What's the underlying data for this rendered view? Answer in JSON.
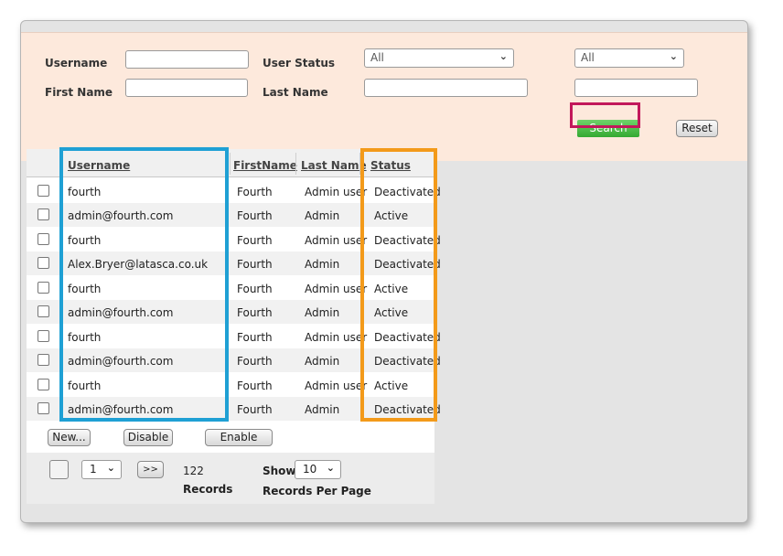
{
  "filters": {
    "username_label": "Username",
    "first_name_label": "First Name",
    "user_status_label": "User Status",
    "last_name_label": "Last Name",
    "user_status_value": "All",
    "second_select_value": "All",
    "username_value": "",
    "first_name_value": "",
    "last_name_value": "",
    "extra_value": "",
    "search_label": "Search",
    "reset_label": "Reset"
  },
  "table": {
    "headers": [
      "Username",
      "FirstName",
      "Last Name",
      "Status"
    ],
    "rows": [
      [
        "fourth",
        "Fourth",
        "Admin user",
        "Deactivated"
      ],
      [
        "admin@fourth.com",
        "Fourth",
        "Admin",
        "Active"
      ],
      [
        "fourth",
        "Fourth",
        "Admin user",
        "Deactivated"
      ],
      [
        "Alex.Bryer@latasca.co.uk",
        "Fourth",
        "Admin",
        "Deactivated"
      ],
      [
        "fourth",
        "Fourth",
        "Admin user",
        "Active"
      ],
      [
        "admin@fourth.com",
        "Fourth",
        "Admin",
        "Active"
      ],
      [
        "fourth",
        "Fourth",
        "Admin user",
        "Deactivated"
      ],
      [
        "admin@fourth.com",
        "Fourth",
        "Admin",
        "Deactivated"
      ],
      [
        "fourth",
        "Fourth",
        "Admin user",
        "Active"
      ],
      [
        "admin@fourth.com",
        "Fourth",
        "Admin",
        "Deactivated"
      ]
    ]
  },
  "actions": {
    "new_label": "New...",
    "disable_label": "Disable",
    "enable_label": "Enable"
  },
  "pager": {
    "page_value": "1",
    "next_label": ">>",
    "records_count": "122",
    "records_label": "Records",
    "show_label": "Show",
    "per_page_value": "10",
    "per_page_label": "Records Per Page"
  },
  "highlight_colors": {
    "search": "#c2185b",
    "username_column": "#1fa0d4",
    "status_column": "#f39a1a"
  }
}
